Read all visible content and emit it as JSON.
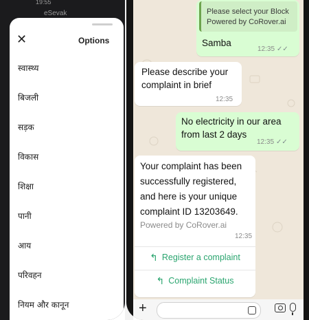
{
  "left_screen": {
    "status_time": "19:55",
    "app_name": "eSevak",
    "sheet": {
      "title": "Options",
      "items": [
        {
          "label": "स्वास्थ्य"
        },
        {
          "label": "बिजली"
        },
        {
          "label": "सड़क"
        },
        {
          "label": "विकास"
        },
        {
          "label": "शिक्षा"
        },
        {
          "label": "पानी"
        },
        {
          "label": "आय"
        },
        {
          "label": "परिवहन"
        },
        {
          "label": "नियम और कानून"
        }
      ]
    }
  },
  "chat": {
    "messages": [
      {
        "dir": "out",
        "quote": "Please select your Block\nPowered by CoRover.ai",
        "text": "Samba",
        "time": "12:35",
        "ticks": "✓✓"
      },
      {
        "dir": "in",
        "text": "Please describe your\ncomplaint in brief",
        "time": "12:35"
      },
      {
        "dir": "out",
        "text": "No electricity in our area\nfrom last 2 days",
        "time": "12:35",
        "ticks": "✓✓"
      },
      {
        "dir": "in",
        "text": "Your complaint has been\nsuccessfully registered,\nand here is your unique\ncomplaint ID 13203649.",
        "footer": "Powered by CoRover.ai",
        "time": "12:35"
      }
    ],
    "actions": [
      {
        "label": "Register a complaint"
      },
      {
        "label": "Complaint Status"
      }
    ]
  },
  "colors": {
    "accent_green": "#2aa56f",
    "outgoing_bubble": "#d9fdd3",
    "chat_background": "#efe7da"
  }
}
